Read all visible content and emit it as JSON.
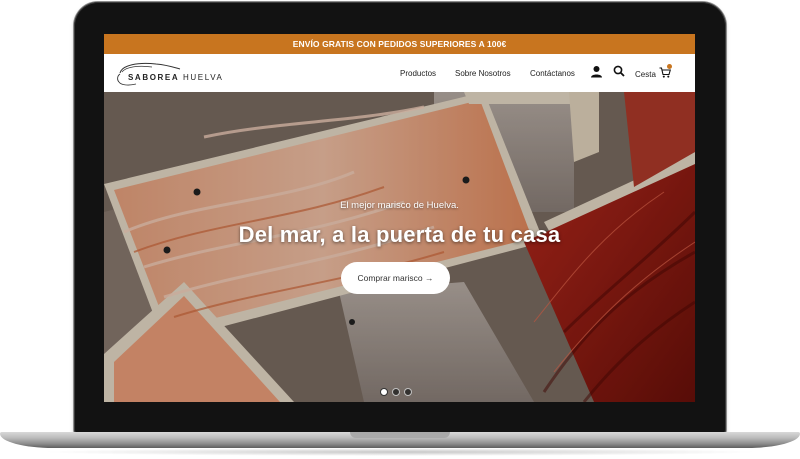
{
  "promo_bar": {
    "text": "ENVÍO GRATIS CON PEDIDOS SUPERIORES A 100€"
  },
  "brand": {
    "logo_text_bold": "SABOREA",
    "logo_text_light": "HUELVA"
  },
  "nav": {
    "items": [
      {
        "label": "Productos"
      },
      {
        "label": "Sobre Nosotros"
      },
      {
        "label": "Contáctanos"
      }
    ],
    "account_icon": "user-icon",
    "search_icon": "search-icon",
    "cart_label": "Cesta",
    "cart_icon": "cart-icon"
  },
  "hero": {
    "kicker": "El mejor marisco de Huelva.",
    "title": "Del mar, a la puerta de tu casa",
    "cta_label": "Comprar marisco →",
    "carousel": {
      "slides": 3,
      "active": 1
    }
  },
  "colors": {
    "accent": "#c8751f",
    "cta_bg": "#ffffff"
  }
}
